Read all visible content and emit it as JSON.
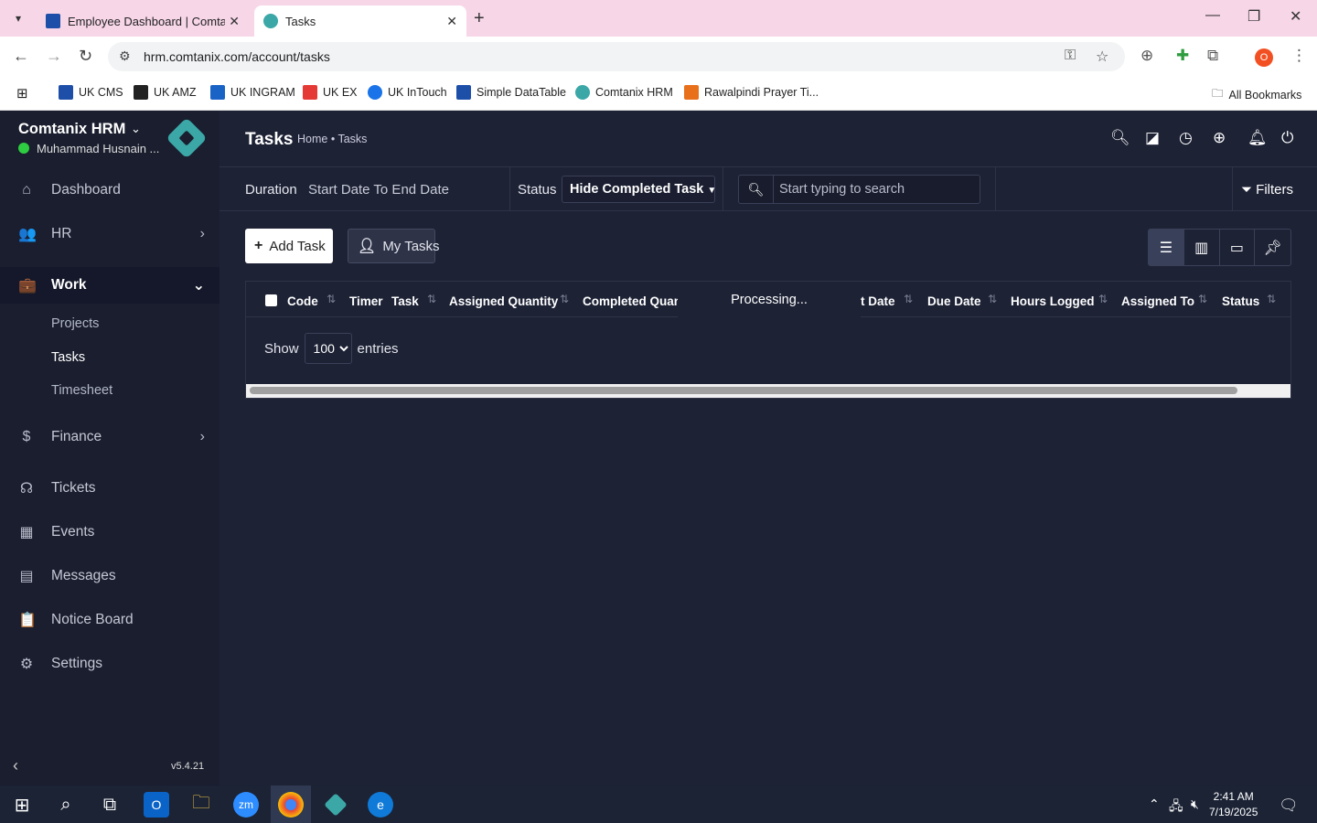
{
  "browser": {
    "tabs": [
      {
        "label": "Employee Dashboard | Comtanix",
        "active": false,
        "favicon_color": "#1e4fa8"
      },
      {
        "label": "Tasks",
        "active": true,
        "favicon_color": "#3ba7a7"
      }
    ],
    "url": "hrm.comtanix.com/account/tasks",
    "profile_initial": "O",
    "bookmarks": [
      {
        "label": "UK CMS",
        "color": "#1e4fa8"
      },
      {
        "label": "UK AMZ",
        "color": "#222222"
      },
      {
        "label": "UK INGRAM",
        "color": "#1a63c6"
      },
      {
        "label": "UK EX",
        "color": "#e53935"
      },
      {
        "label": "UK InTouch",
        "color": "#1a73e8"
      },
      {
        "label": "Simple DataTable",
        "color": "#1e4fa8"
      },
      {
        "label": "Comtanix HRM",
        "color": "#3ba7a7"
      },
      {
        "label": "Rawalpindi Prayer Ti...",
        "color": "#e8701a"
      }
    ],
    "all_bookmarks": "All Bookmarks"
  },
  "sidebar": {
    "brand": "Comtanix HRM",
    "user": "Muhammad Husnain ...",
    "items": [
      {
        "label": "Dashboard",
        "icon": "home-icon"
      },
      {
        "label": "HR",
        "icon": "users-icon"
      },
      {
        "label": "Work",
        "icon": "briefcase-icon"
      },
      {
        "label": "Finance",
        "icon": "dollar-icon"
      },
      {
        "label": "Tickets",
        "icon": "headset-icon"
      },
      {
        "label": "Events",
        "icon": "calendar-icon"
      },
      {
        "label": "Messages",
        "icon": "message-icon"
      },
      {
        "label": "Notice Board",
        "icon": "clipboard-icon"
      },
      {
        "label": "Settings",
        "icon": "gear-icon"
      }
    ],
    "work_sub": [
      "Projects",
      "Tasks",
      "Timesheet"
    ],
    "version": "v5.4.21"
  },
  "header": {
    "title": "Tasks",
    "breadcrumb": "Home • Tasks"
  },
  "filters": {
    "duration_label": "Duration",
    "duration_value": "Start Date To End Date",
    "status_label": "Status",
    "status_value": "Hide Completed Task",
    "search_placeholder": "Start typing to search",
    "filters_label": "Filters"
  },
  "actions": {
    "add_task": "Add Task",
    "my_tasks": "My Tasks"
  },
  "table": {
    "columns": [
      "Code",
      "Timer",
      "Task",
      "Assigned Quantity",
      "Completed Quan",
      "t Date",
      "Due Date",
      "Hours Logged",
      "Assigned To",
      "Status"
    ],
    "processing": "Processing...",
    "show_label": "Show",
    "entries_value": "100",
    "entries_label": "entries"
  },
  "taskbar": {
    "time": "2:41 AM",
    "date": "7/19/2025"
  }
}
